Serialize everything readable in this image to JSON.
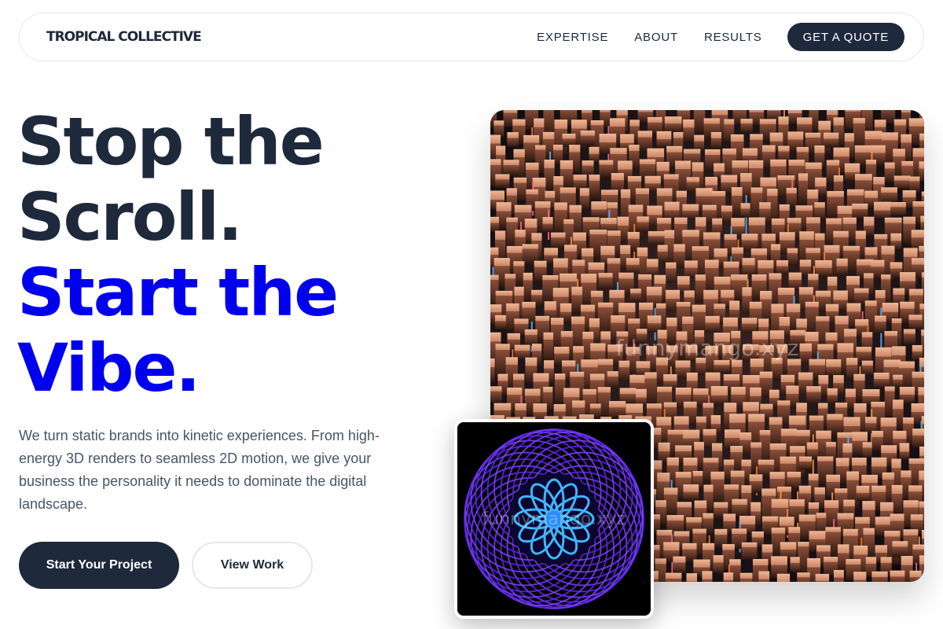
{
  "nav": {
    "logo": "TROPICAL COLLECTIVE",
    "links": [
      "EXPERTISE",
      "ABOUT",
      "RESULTS"
    ],
    "cta": "GET A QUOTE"
  },
  "hero": {
    "headline": [
      "Stop the",
      "Scroll.",
      "Start the",
      "Vibe."
    ],
    "subtext": "We turn static brands into kinetic experiences. From high-energy 3D renders to seamless 2D motion, we give your business the personality it needs to dominate the digital landscape.",
    "primary_button": "Start Your Project",
    "secondary_button": "View Work"
  },
  "images": {
    "main_watermark": "funnymango.xyz",
    "inset_watermark": "funnymango.xyz"
  },
  "colors": {
    "dark": "#1e293b",
    "accent_blue": "#0000ee",
    "body_text": "#475569"
  }
}
